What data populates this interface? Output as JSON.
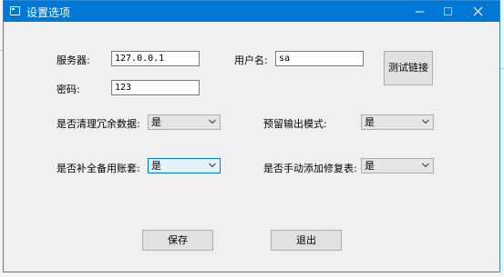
{
  "window": {
    "title": "设置选项",
    "accent_color": "#0078d7",
    "controls": {
      "minimize_icon": "minimize-icon",
      "maximize_icon": "maximize-icon",
      "close_icon": "close-icon"
    }
  },
  "connection": {
    "server_label": "服务器:",
    "server_value": "127.0.0.1",
    "user_label": "用户名:",
    "user_value": "sa",
    "password_label": "密码:",
    "password_value": "123",
    "test_button": "测试链接"
  },
  "options": {
    "clean_redundant": {
      "label": "是否清理冗余数据:",
      "value": "是"
    },
    "reserve_output": {
      "label": "预留输出模式:",
      "value": "是"
    },
    "fill_backup": {
      "label": "是否补全备用账套:",
      "value": "是"
    },
    "manual_repair": {
      "label": "是否手动添加修复表:",
      "value": "是"
    }
  },
  "actions": {
    "save": "保存",
    "exit": "退出"
  }
}
